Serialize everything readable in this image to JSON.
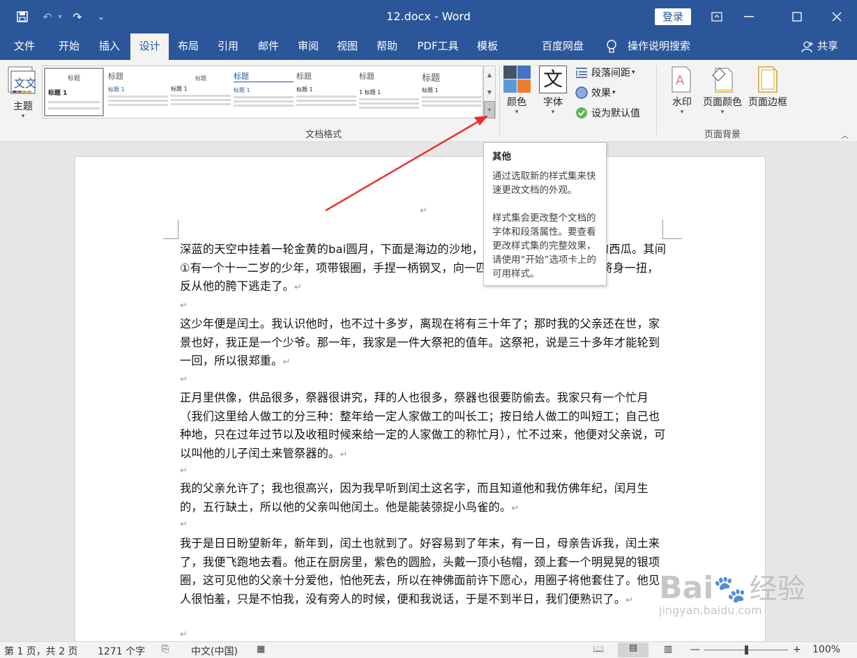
{
  "titlebar": {
    "title": "12.docx  -  Word",
    "login": "登录",
    "qa_save": "💾",
    "qa_undo": "↶",
    "qa_redo": "↷",
    "qa_customize": "⌄"
  },
  "tabs": [
    {
      "label": "文件"
    },
    {
      "label": "开始"
    },
    {
      "label": "插入"
    },
    {
      "label": "设计"
    },
    {
      "label": "布局"
    },
    {
      "label": "引用"
    },
    {
      "label": "邮件"
    },
    {
      "label": "审阅"
    },
    {
      "label": "视图"
    },
    {
      "label": "帮助"
    },
    {
      "label": "PDF工具"
    },
    {
      "label": "模板"
    },
    {
      "label": "百度网盘"
    },
    {
      "label": "操作说明搜索"
    },
    {
      "label": "共享"
    }
  ],
  "ribbon": {
    "theme": "主题",
    "gallery_items": [
      {
        "title": "标题",
        "heading": "标题 1"
      },
      {
        "title": "标题",
        "heading": "标题 1"
      },
      {
        "title": "标题",
        "heading": "标题 1"
      },
      {
        "title": "标题",
        "heading": "标题 1"
      },
      {
        "title": "标题",
        "heading": "标题 1"
      },
      {
        "title": "标题",
        "heading": "1  标题 1"
      },
      {
        "title": "标题",
        "heading": "标题 1"
      }
    ],
    "colors": "颜色",
    "fonts": "字体",
    "fonts_glyph": "文",
    "paragraph_spacing": "段落间距",
    "effects": "效果",
    "set_default": "设为默认值",
    "group_doc_format": "文档格式",
    "watermark": "水印",
    "page_color": "页面颜色",
    "page_border": "页面边框",
    "group_page_bg": "页面背景"
  },
  "tooltip": {
    "title": "其他",
    "line1": "通过选取新的样式集来快速更改文档的外观。",
    "line2": "样式集会更改整个文档的字体和段落属性。要查看更改样式集的完整效果，请使用“开始”选项卡上的可用样式。"
  },
  "document": {
    "paragraphs": [
      "深蓝的天空中挂着一轮金黄的bai圆月，下面是海边的沙地，都种着一望无际的碧绿的西瓜。其间①有一个十一二岁的少年，项带银圈，手捏一柄钢叉，向一匹猹尽力的刺去。那猹却将身一扭，反从他的胯下逃走了。",
      "这少年便是闰土。我认识他时，也不过十多岁，离现在将有三十年了；那时我的父亲还在世，家景也好，我正是一个少爷。那一年，我家是一件大祭祀的值年。这祭祀，说是三十多年才能轮到一回，所以很郑重。",
      "正月里供像，供品很多，祭器很讲究，拜的人也很多，祭器也很要防偷去。我家只有一个忙月（我们这里给人做工的分三种：整年给一定人家做工的叫长工；按日给人做工的叫短工；自己也种地，只在过年过节以及收租时候来给一定的人家做工的称忙月），忙不过来，他便对父亲说，可以叫他的儿子闰土来管祭器的。",
      "我的父亲允许了；我也很高兴，因为我早听到闰土这名字，而且知道他和我仿佛年纪，闰月生的，五行缺土，所以他的父亲叫他闰土。他是能装弶捉小鸟雀的。",
      "我于是日日盼望新年，新年到，闰土也就到了。好容易到了年末，有一日，母亲告诉我，闰土来了，我便飞跑地去看。他正在厨房里，紫色的圆脸，头戴一顶小毡帽，颈上套一个明晃晃的银项圈，这可见他的父亲十分爱他，怕他死去，所以在神佛面前许下愿心，用圈子将他套住了。他见人很怕羞，只是不怕我，没有旁人的时候，便和我说话，于是不到半日，我们便熟识了。"
    ]
  },
  "statusbar": {
    "page": "第 1 页，共 2 页",
    "words": "1271 个字",
    "language": "中文(中国)",
    "zoom": "100%"
  },
  "watermark": {
    "brand": "Bai",
    "brand2": "经验",
    "url": "jingyan.baidu.com"
  }
}
